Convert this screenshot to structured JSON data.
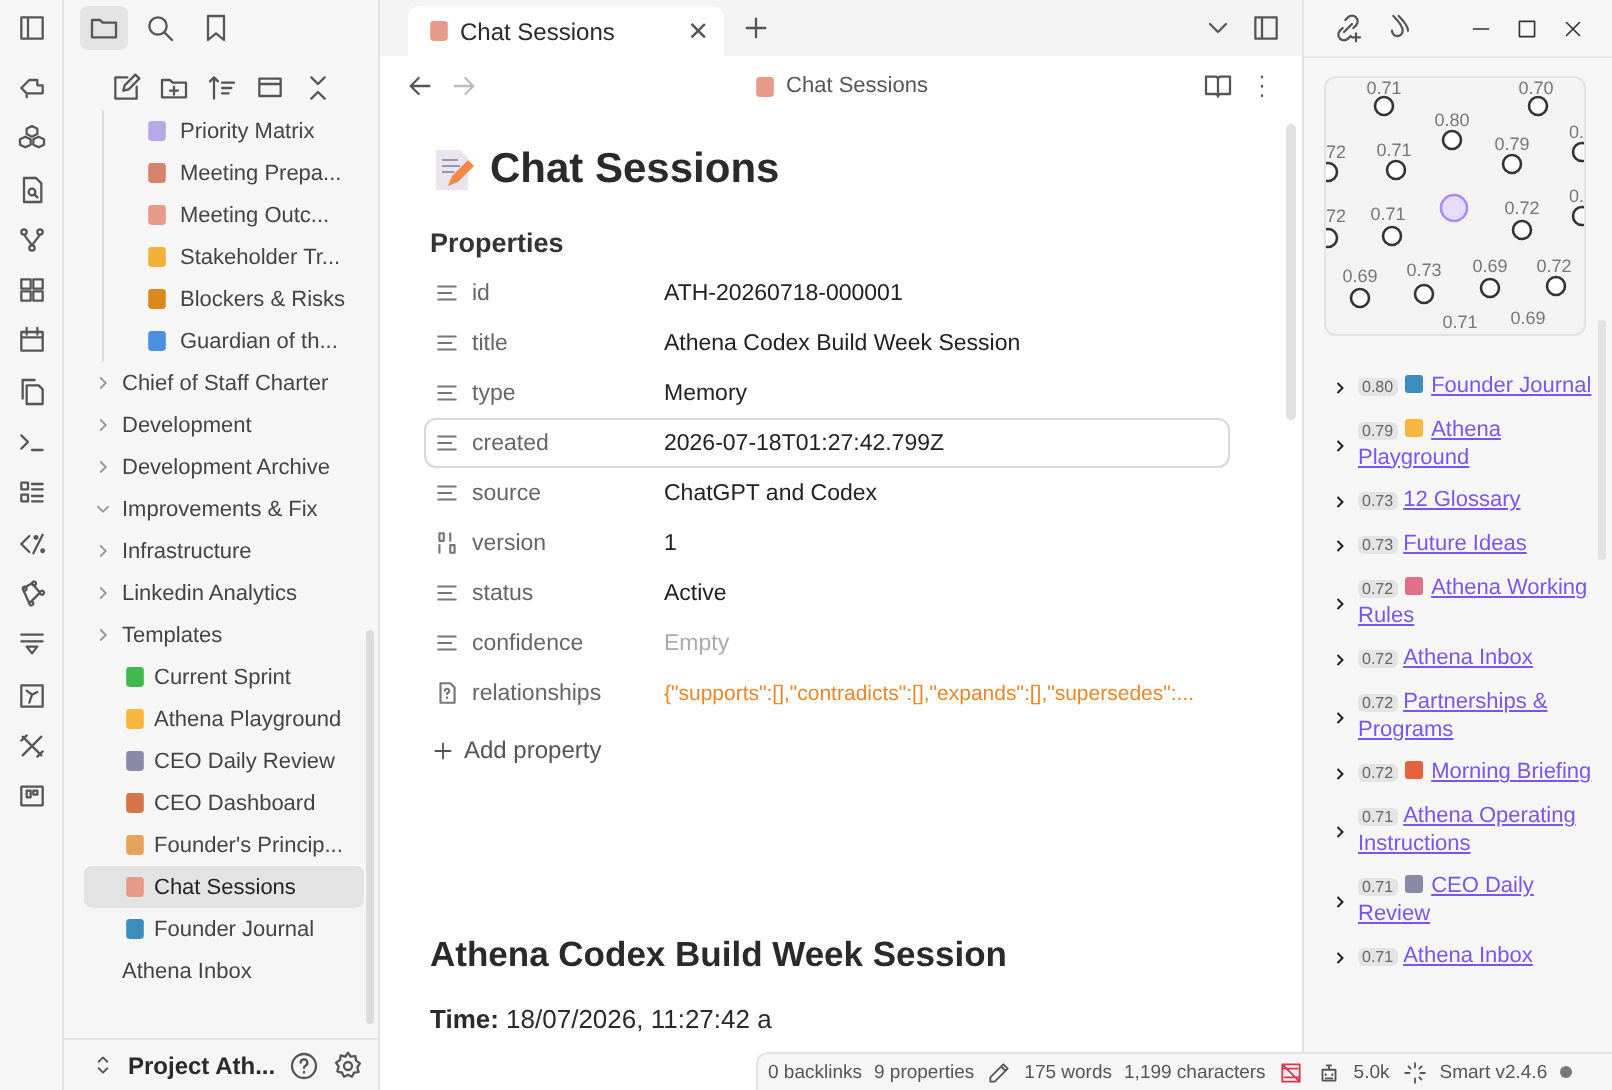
{
  "sidebar_tabs": [
    {
      "kind": "files",
      "selected": true
    },
    {
      "kind": "search",
      "selected": false
    },
    {
      "kind": "bookmarks",
      "selected": false
    }
  ],
  "file_tree": {
    "partial_folder": {
      "children": [
        {
          "label": "Priority Matrix",
          "color": "#b7a8e6",
          "selected": false
        },
        {
          "label": "Meeting Prepa...",
          "color": "#d9826b",
          "selected": false
        },
        {
          "label": "Meeting Outc...",
          "color": "#e59a8a",
          "selected": false
        },
        {
          "label": "Stakeholder Tr...",
          "color": "#f2b23a",
          "selected": false
        },
        {
          "label": "Blockers & Risks",
          "color": "#d98a1c",
          "selected": false
        },
        {
          "label": "Guardian of th...",
          "color": "#4a8fe0",
          "selected": false
        }
      ]
    },
    "items": [
      {
        "kind": "folder",
        "label": "Chief of Staff Charter",
        "expanded": false
      },
      {
        "kind": "folder",
        "label": "Development",
        "expanded": false
      },
      {
        "kind": "folder",
        "label": "Development Archive",
        "expanded": false
      },
      {
        "kind": "folder",
        "label": "Improvements & Fix",
        "expanded": true
      },
      {
        "kind": "folder",
        "label": "Infrastructure",
        "expanded": false
      },
      {
        "kind": "folder",
        "label": "Linkedin Analytics",
        "expanded": false
      },
      {
        "kind": "folder",
        "label": "Templates",
        "expanded": false
      },
      {
        "kind": "file",
        "label": "Current Sprint",
        "color": "#3fb950",
        "selected": false
      },
      {
        "kind": "file",
        "label": "Athena Playground",
        "color": "#f6b73c",
        "selected": false
      },
      {
        "kind": "file",
        "label": "CEO Daily Review",
        "color": "#8a8aa8",
        "selected": false
      },
      {
        "kind": "file",
        "label": "CEO Dashboard",
        "color": "#d8744a",
        "selected": false
      },
      {
        "kind": "file",
        "label": "Founder's Princip...",
        "color": "#e5a45a",
        "selected": false
      },
      {
        "kind": "file",
        "label": "Chat Sessions",
        "color": "#e59a8a",
        "selected": true
      },
      {
        "kind": "file",
        "label": "Founder Journal",
        "color": "#3c8dbd",
        "selected": false
      },
      {
        "kind": "file",
        "label": "Athena Inbox",
        "selected": false
      }
    ]
  },
  "vault": {
    "name": "Project Ath..."
  },
  "tab": {
    "title": "Chat Sessions",
    "close": "×"
  },
  "note": {
    "breadcrumb": "Chat Sessions",
    "title": "Chat Sessions",
    "properties_heading": "Properties",
    "properties": [
      {
        "kind": "text",
        "key": "id",
        "value": "ATH-20260718-000001",
        "focused": false
      },
      {
        "kind": "text",
        "key": "title",
        "value": "Athena Codex Build Week Session",
        "focused": false
      },
      {
        "kind": "text",
        "key": "type",
        "value": "Memory",
        "focused": false
      },
      {
        "kind": "text",
        "key": "created",
        "value": "2026-07-18T01:27:42.799Z",
        "focused": true
      },
      {
        "kind": "text",
        "key": "source",
        "value": "ChatGPT and Codex",
        "focused": false
      },
      {
        "kind": "number",
        "key": "version",
        "value": "1",
        "focused": false
      },
      {
        "kind": "text",
        "key": "status",
        "value": "Active",
        "focused": false
      },
      {
        "kind": "text",
        "key": "confidence",
        "placeholder": "Empty",
        "focused": false
      },
      {
        "kind": "unknown",
        "key": "relationships",
        "value": "{\"supports\":[],\"contradicts\":[],\"expands\":[],\"supersedes\":...",
        "focused": false
      }
    ],
    "add_property": "Add property",
    "heading": "Athena Codex Build Week Session",
    "time_line": "**Time:** 18/07/2026, 11:27:42 a"
  },
  "graph": {
    "nodes": [
      {
        "label": "0.71"
      },
      {
        "label": "0.70"
      },
      {
        "label": "0.80"
      },
      {
        "label": "72"
      },
      {
        "label": "0.71"
      },
      {
        "label": "0.79"
      },
      {
        "label": "0."
      },
      {
        "label": "72"
      },
      {
        "label": "0.71"
      },
      {
        "kind": "current"
      },
      {
        "label": "0.72"
      },
      {
        "label": "0."
      },
      {
        "label": "0.69"
      },
      {
        "label": "0.73"
      },
      {
        "label": "0.69"
      },
      {
        "label": "0.72"
      },
      {
        "label": "0.71"
      },
      {
        "label": "0.69"
      }
    ]
  },
  "connections": [
    {
      "score": "0.80",
      "color": "#3c8dbd",
      "title": "Founder Journal"
    },
    {
      "score": "0.79",
      "color": "#f6b73c",
      "title": "Athena Playground"
    },
    {
      "score": "0.73",
      "title": "12 Glossary"
    },
    {
      "score": "0.73",
      "title": "Future Ideas"
    },
    {
      "score": "0.72",
      "color": "#e0708a",
      "title": "Athena Working Rules"
    },
    {
      "score": "0.72",
      "title": "Athena Inbox"
    },
    {
      "score": "0.72",
      "title": "Partnerships & Programs"
    },
    {
      "score": "0.72",
      "color": "#e8603c",
      "title": "Morning Briefing"
    },
    {
      "score": "0.71",
      "title": "Athena Operating Instructions"
    },
    {
      "score": "0.71",
      "color": "#8a8aa8",
      "title": "CEO Daily Review"
    },
    {
      "score": "0.71",
      "title": "Athena Inbox"
    }
  ],
  "status_bar": {
    "backlinks": "0 backlinks",
    "properties": "9 properties",
    "words": "175 words",
    "characters": "1,199 characters",
    "tokens": "5.0k",
    "plugin": "Smart v2.4.6"
  }
}
